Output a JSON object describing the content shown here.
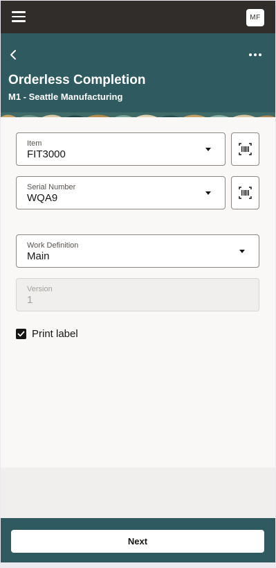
{
  "topbar": {
    "menu_icon": "hamburger-menu-icon",
    "avatar_initials": "MF"
  },
  "header": {
    "back_icon": "chevron-left-icon",
    "more_icon": "more-horizontal-icon",
    "title": "Orderless Completion",
    "subtitle": "M1 - Seattle Manufacturing"
  },
  "form": {
    "item": {
      "label": "Item",
      "value": "FIT3000"
    },
    "serial_number": {
      "label": "Serial Number",
      "value": "WQA9"
    },
    "work_definition": {
      "label": "Work Definition",
      "value": "Main"
    },
    "version": {
      "label": "Version",
      "value": "1"
    },
    "print_label": {
      "label": "Print label",
      "checked": true
    },
    "scan_icon": "barcode-scan-icon"
  },
  "footer": {
    "next_label": "Next"
  },
  "colors": {
    "topbar": "#312d2a",
    "header": "#2f5a5f",
    "content_bg": "#f9f8f6"
  }
}
